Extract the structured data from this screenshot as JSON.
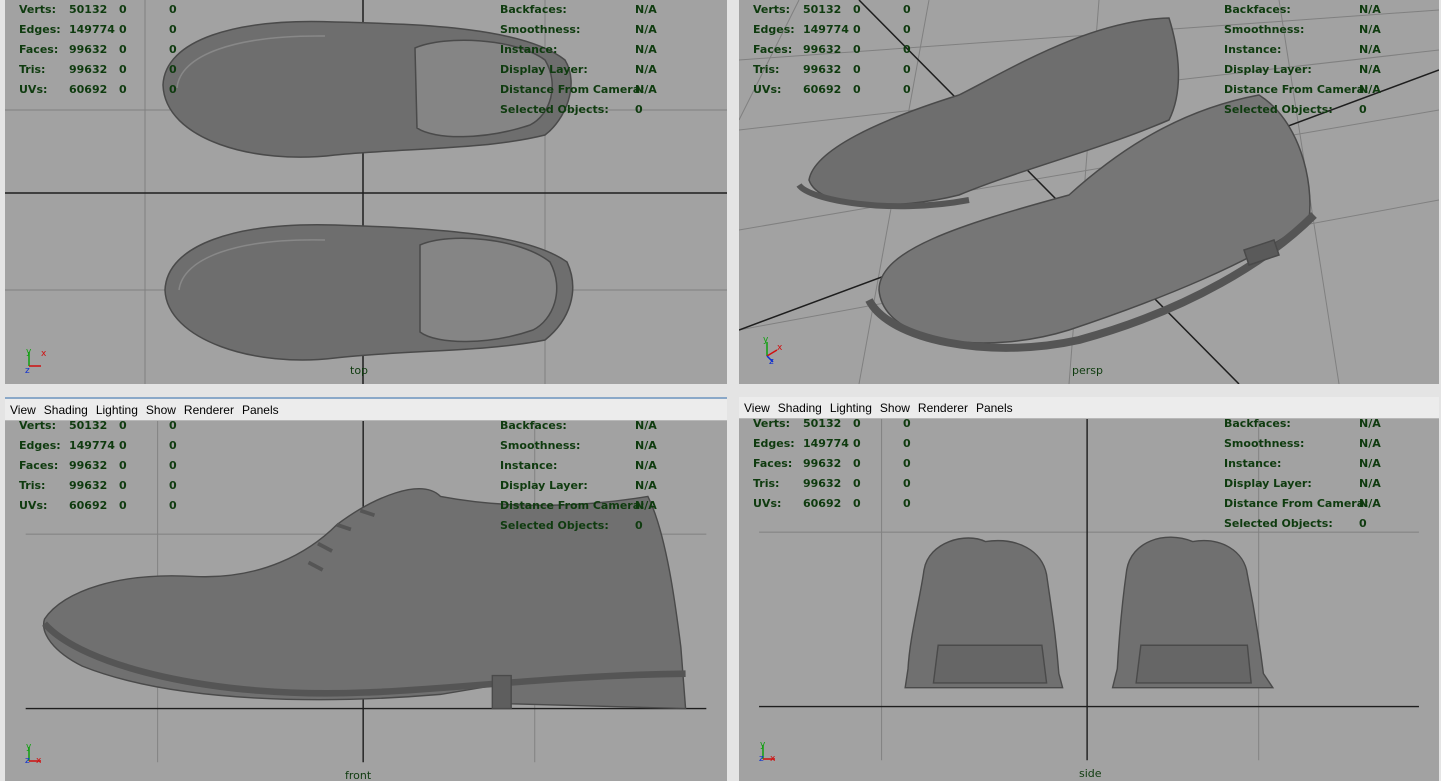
{
  "menu": [
    "View",
    "Shading",
    "Lighting",
    "Show",
    "Renderer",
    "Panels"
  ],
  "hud_left": [
    {
      "label": "Verts:",
      "value": "50132",
      "a": "0",
      "b": "0"
    },
    {
      "label": "Edges:",
      "value": "149774",
      "a": "0",
      "b": "0"
    },
    {
      "label": "Faces:",
      "value": "99632",
      "a": "0",
      "b": "0"
    },
    {
      "label": "Tris:",
      "value": "99632",
      "a": "0",
      "b": "0"
    },
    {
      "label": "UVs:",
      "value": "60692",
      "a": "0",
      "b": "0"
    }
  ],
  "hud_right": [
    {
      "label": "Backfaces:",
      "value": "N/A"
    },
    {
      "label": "Smoothness:",
      "value": "N/A"
    },
    {
      "label": "Instance:",
      "value": "N/A"
    },
    {
      "label": "Display Layer:",
      "value": "N/A"
    },
    {
      "label": "Distance From Camera:",
      "value": "N/A"
    },
    {
      "label": "Selected Objects:",
      "value": "0"
    }
  ],
  "panes": {
    "top": {
      "camera": "top",
      "axis": [
        "y",
        "x",
        "z"
      ]
    },
    "persp": {
      "camera": "persp",
      "axis": [
        "y",
        "x",
        "z"
      ]
    },
    "front": {
      "camera": "front",
      "axis": [
        "y",
        "z",
        "x"
      ]
    },
    "side": {
      "camera": "side",
      "axis": [
        "y",
        "z",
        "x"
      ]
    }
  },
  "colors": {
    "viewport_bg": "#a2a2a2",
    "grid": "#7f7f7f",
    "axis_line": "#1e1e1e",
    "hud_text": "#0f3b0f",
    "mesh": "#6e6e6e",
    "x_axis": "#d01010",
    "y_axis": "#10a010",
    "z_axis": "#1030d0"
  }
}
